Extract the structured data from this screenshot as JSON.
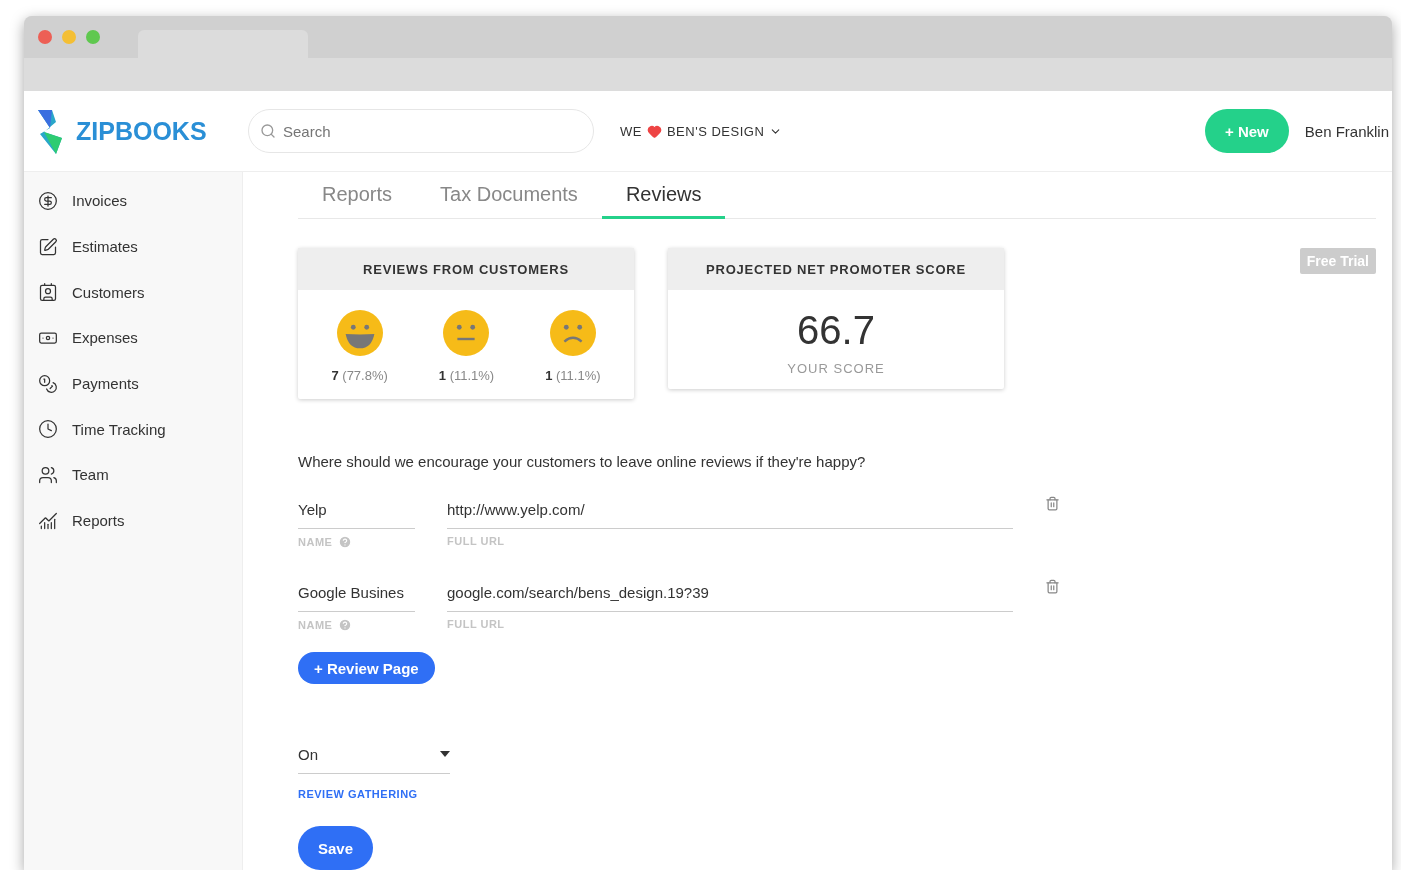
{
  "brand": {
    "name": "ZIPBOOKS"
  },
  "search": {
    "placeholder": "Search"
  },
  "company": {
    "prefix": "WE",
    "name": "BEN'S DESIGN"
  },
  "header_actions": {
    "new_button": "+ New",
    "user": "Ben Franklin"
  },
  "sidebar": {
    "items": [
      {
        "label": "Invoices"
      },
      {
        "label": "Estimates"
      },
      {
        "label": "Customers"
      },
      {
        "label": "Expenses"
      },
      {
        "label": "Payments"
      },
      {
        "label": "Time Tracking"
      },
      {
        "label": "Team"
      },
      {
        "label": "Reports"
      }
    ]
  },
  "tabs": [
    {
      "label": "Reports",
      "selected": false
    },
    {
      "label": "Tax Documents",
      "selected": false
    },
    {
      "label": "Reviews",
      "selected": true
    }
  ],
  "reviews_card": {
    "title": "REVIEWS FROM CUSTOMERS",
    "items": [
      {
        "kind": "happy",
        "count": "**7** (77.8%)"
      },
      {
        "kind": "neutral",
        "count": "**1** (11.1%)"
      },
      {
        "kind": "sad",
        "count": "**1** (11.1%)"
      }
    ]
  },
  "score_card": {
    "title": "PROJECTED NET PROMOTER SCORE",
    "score": "66.7",
    "caption": "YOUR SCORE"
  },
  "badge": "Free Trial",
  "question": "Where should we encourage your customers to leave online reviews if they're happy?",
  "review_pages": [
    {
      "name": "Yelp",
      "name_label": "NAME",
      "url": "http://www.yelp.com/",
      "url_label": "FULL URL"
    },
    {
      "name": "Google Busines",
      "name_label": "NAME",
      "url": "google.com/search/bens_design.19?39",
      "url_label": "FULL URL"
    }
  ],
  "add_button": "+ Review Page",
  "gathering": {
    "value": "On",
    "label": "REVIEW GATHERING"
  },
  "save_button": "Save"
}
